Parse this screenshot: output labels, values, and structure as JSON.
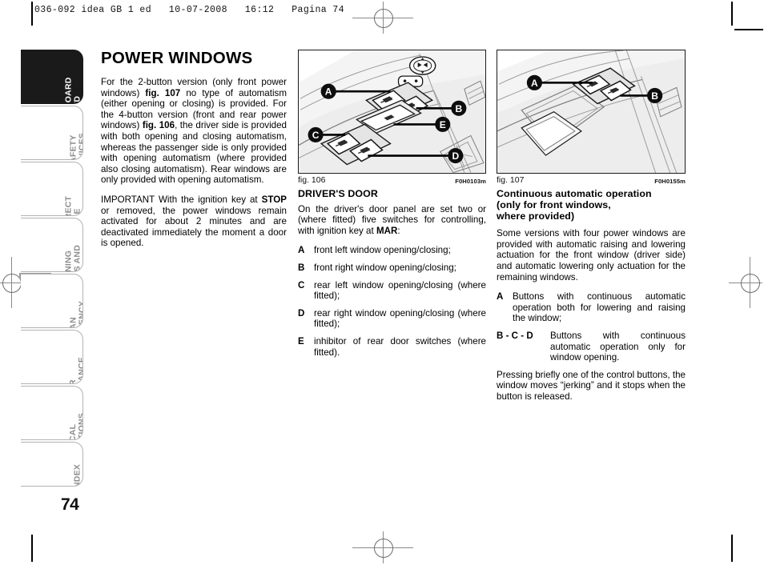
{
  "print_header": "036-092 idea GB 1 ed   10-07-2008   16:12   Pagina 74",
  "page_number": "74",
  "sidebar": {
    "tabs": [
      {
        "label": "DASHBOARD\nAND CONTROLS",
        "active": true
      },
      {
        "label": "SAFETY\nDEVICES",
        "active": false
      },
      {
        "label": "CORRECT USE\nOF THE CAR",
        "active": false
      },
      {
        "label": "WARNING\nLIGHTS AND\nMESSAGES",
        "active": false
      },
      {
        "label": "IN AN\nEMERGENCY",
        "active": false
      },
      {
        "label": "CAR\nMAINTENANCE",
        "active": false
      },
      {
        "label": "TECHNICAL\nSPECIFICATIONS",
        "active": false
      },
      {
        "label": "INDEX",
        "active": false
      }
    ]
  },
  "column_1": {
    "title": "POWER WINDOWS",
    "paragraph_1_a": "For the 2-button version (only front power windows) ",
    "paragraph_1_fig_a": "fig. 107",
    "paragraph_1_b": " no type of automatism (either opening or closing) is provided. For the 4-button version (front and rear power windows) ",
    "paragraph_1_fig_b": "fig. 106",
    "paragraph_1_c": ", the driver side is provided with both opening and closing automatism, whereas the passenger side is only provided with opening automatism (where provided also closing automatism). Rear windows are only provided with opening automatism.",
    "paragraph_2_a": "IMPORTANT With the ignition key at ",
    "paragraph_2_bold": "STOP",
    "paragraph_2_b": " or removed, the power windows remain activated for about 2 minutes and are deactivated immediately the moment a door is opened."
  },
  "column_2": {
    "figure": {
      "caption": "fig. 106",
      "code": "F0H0103m",
      "callouts": [
        "A",
        "B",
        "C",
        "D",
        "E"
      ],
      "description": "four-button driver door power window switch panel"
    },
    "subhead": "DRIVER'S DOOR",
    "intro_a": "On the driver's door panel are set two or (where fitted) five switches for controlling, with ignition key at ",
    "intro_bold": "MAR",
    "intro_b": ":",
    "items": [
      {
        "key": "A",
        "text": "front left window opening/closing;"
      },
      {
        "key": "B",
        "text": "front right window opening/closing;"
      },
      {
        "key": "C",
        "text": "rear left window opening/closing (where fitted);"
      },
      {
        "key": "D",
        "text": "rear right window opening/closing (where fitted);"
      },
      {
        "key": "E",
        "text": "inhibitor of rear door switches (where fitted)."
      }
    ]
  },
  "column_3": {
    "figure": {
      "caption": "fig. 107",
      "code": "F0H0155m",
      "callouts": [
        "A",
        "B"
      ],
      "description": "two-button passenger door power window switch panel"
    },
    "subhead": "Continuous automatic operation\n(only for front windows,\nwhere provided)",
    "paragraph_1": "Some versions with four power windows are provided with automatic raising and lowering actuation for the front window (driver side) and automatic lowering only actuation for the remaining windows.",
    "items": [
      {
        "key": "A",
        "text": "Buttons with continuous automatic operation both for lowering and raising the window;"
      },
      {
        "key": "B - C - D",
        "text": "Buttons with continuous automatic operation only for window opening."
      }
    ],
    "paragraph_2": "Pressing briefly one of the control buttons, the window moves “jerking” and it stops when the button is released."
  },
  "colors": {
    "active_tab_bg": "#1a1a1a",
    "inactive_tab_text": "#8c8c8c",
    "tab_border": "#b3b3b3",
    "text": "#000000",
    "figure_line": "#1a1a1a",
    "figure_fill_light": "#f2f2f2",
    "figure_fill_mid": "#d9d9d9"
  }
}
